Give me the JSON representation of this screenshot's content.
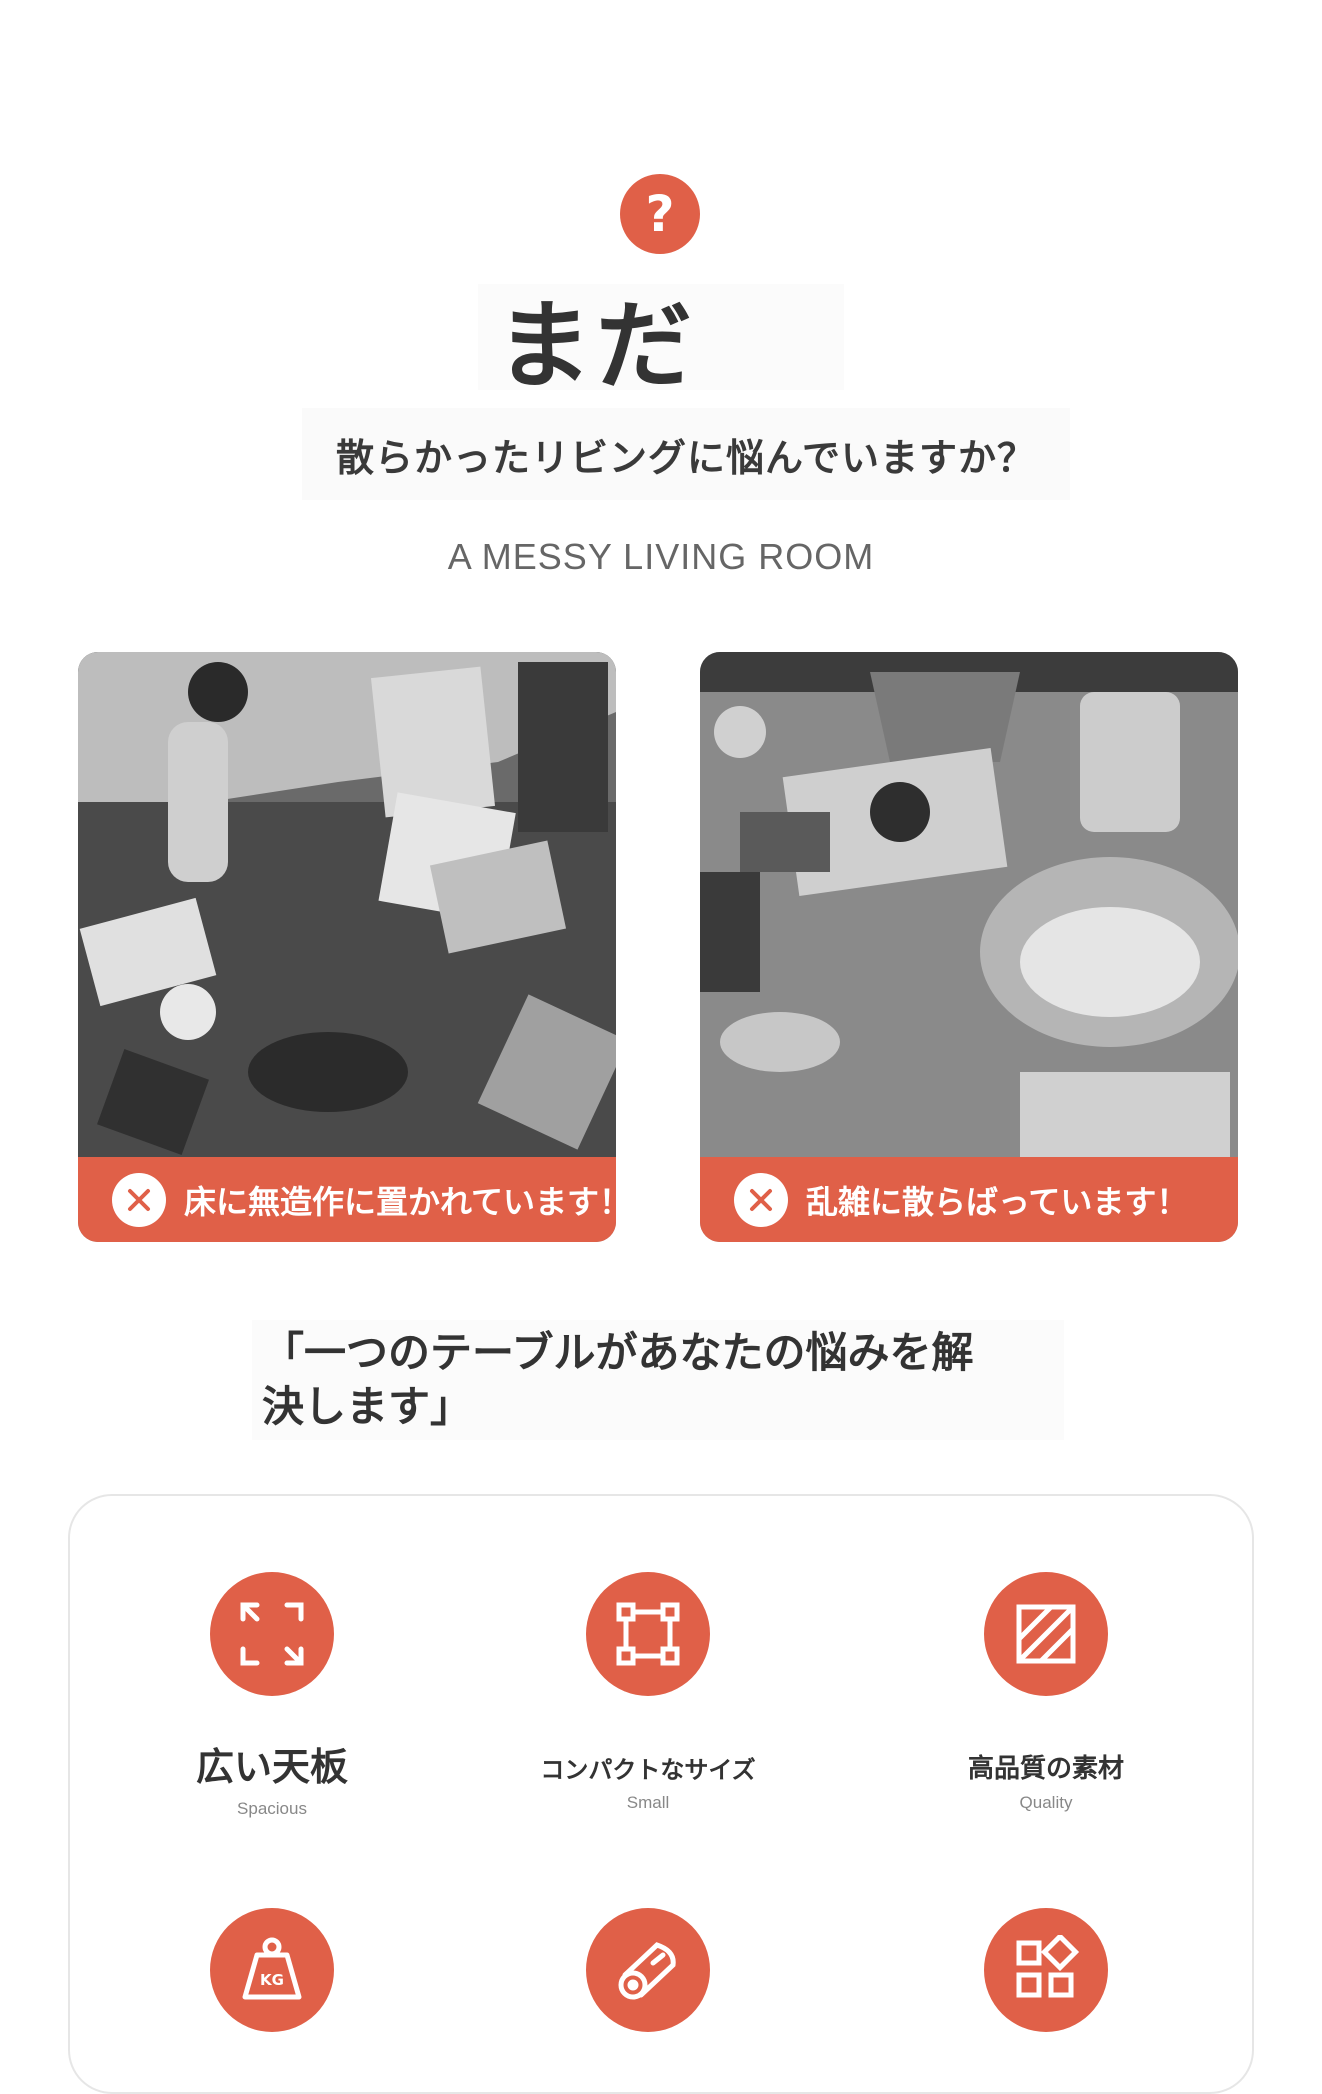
{
  "header": {
    "question_icon": "?",
    "title": "まだ",
    "subtitle": "散らかったリビングに悩んでいますか？",
    "english": "A MESSY LIVING ROOM"
  },
  "cards": [
    {
      "caption": "床に無造作に置かれています！",
      "icon": "close-icon"
    },
    {
      "caption": "乱雑に散らばっています！",
      "icon": "close-icon"
    }
  ],
  "solution_quote": {
    "line1": "「一つのテーブルがあなたの悩みを解",
    "line2": "決します」"
  },
  "features": [
    {
      "title": "広い天板",
      "subtitle": "Spacious",
      "icon": "expand-arrows-icon"
    },
    {
      "title": "コンパクトなサイズ",
      "subtitle": "Small",
      "icon": "compact-frame-icon"
    },
    {
      "title": "高品質の素材",
      "subtitle": "Quality",
      "icon": "material-texture-icon"
    },
    {
      "title": "",
      "subtitle": "",
      "icon": "weight-kg-icon",
      "icon_label": "KG"
    },
    {
      "title": "",
      "subtitle": "",
      "icon": "wood-log-icon"
    },
    {
      "title": "",
      "subtitle": "",
      "icon": "modules-grid-icon"
    }
  ],
  "colors": {
    "accent": "#e06048",
    "text": "#333333",
    "muted": "#888888"
  }
}
